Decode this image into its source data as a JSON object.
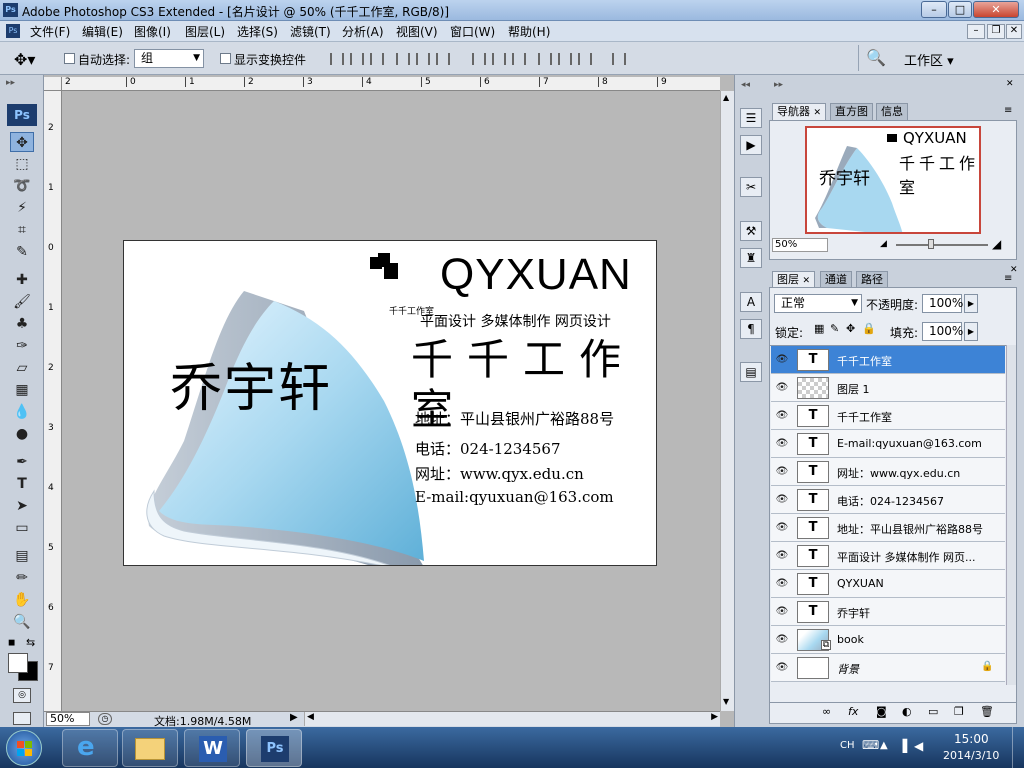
{
  "window": {
    "title": "Adobe Photoshop CS3 Extended - [名片设计 @ 50% (千千工作室, RGB/8)]",
    "app_badge": "Ps"
  },
  "menu": [
    "文件(F)",
    "编辑(E)",
    "图像(I)",
    "图层(L)",
    "选择(S)",
    "滤镜(T)",
    "分析(A)",
    "视图(V)",
    "窗口(W)",
    "帮助(H)"
  ],
  "options": {
    "auto_select_label": "自动选择:",
    "auto_select_value": "组",
    "show_transform_label": "显示变换控件",
    "workspace_label": "工作区 ▾"
  },
  "toolbox": {
    "badge": "Ps"
  },
  "ruler": {
    "top": [
      "2",
      "1",
      "0",
      "1",
      "2",
      "3",
      "4",
      "5",
      "6",
      "7",
      "8",
      "9"
    ],
    "left": [
      "2",
      "1",
      "0",
      "1",
      "2",
      "3",
      "4",
      "5",
      "6",
      "7"
    ]
  },
  "card": {
    "brand_logo_text": "QYXUAN",
    "brand_small": "千千工作室",
    "services": "平面设计 多媒体制作 网页设计",
    "studio_name": "千千工作室",
    "person_name": "乔宇轩",
    "address": "地址：平山县银州广裕路88号",
    "phone": "电话：024-1234567",
    "website": "网址：www.qyx.edu.cn",
    "email": "E-mail:qyuxuan@163.com"
  },
  "status": {
    "zoom": "50%",
    "doc_info": "文档:1.98M/4.58M"
  },
  "navigator": {
    "tabs": [
      "导航器",
      "直方图",
      "信息"
    ],
    "zoom": "50%"
  },
  "layers_panel": {
    "tabs": [
      "图层",
      "通道",
      "路径"
    ],
    "blend_mode": "正常",
    "opacity_label": "不透明度:",
    "opacity_value": "100%",
    "lock_label": "锁定:",
    "fill_label": "填充:",
    "fill_value": "100%",
    "layers": [
      {
        "name": "千千工作室",
        "type": "text",
        "selected": true
      },
      {
        "name": "图层 1",
        "type": "transparent",
        "selected": false
      },
      {
        "name": "千千工作室",
        "type": "text",
        "selected": false
      },
      {
        "name": "E-mail:qyuxuan@163.com",
        "type": "text",
        "selected": false
      },
      {
        "name": "网址：www.qyx.edu.cn",
        "type": "text",
        "selected": false
      },
      {
        "name": "电话：024-1234567",
        "type": "text",
        "selected": false
      },
      {
        "name": "地址：平山县银州广裕路88号",
        "type": "text",
        "selected": false
      },
      {
        "name": "平面设计 多媒体制作 网页...",
        "type": "text",
        "selected": false
      },
      {
        "name": "QYXUAN",
        "type": "text",
        "selected": false
      },
      {
        "name": "乔宇轩",
        "type": "text",
        "selected": false
      },
      {
        "name": "book",
        "type": "image",
        "selected": false
      },
      {
        "name": "背景",
        "type": "background",
        "selected": false
      }
    ]
  },
  "taskbar": {
    "lang": "CH",
    "time": "15:00",
    "date": "2014/3/10",
    "ps_badge": "Ps"
  },
  "colors": {
    "selection": "#3d83d6",
    "book_blue": "#a8d8f0",
    "book_gray": "#9aaabb"
  }
}
